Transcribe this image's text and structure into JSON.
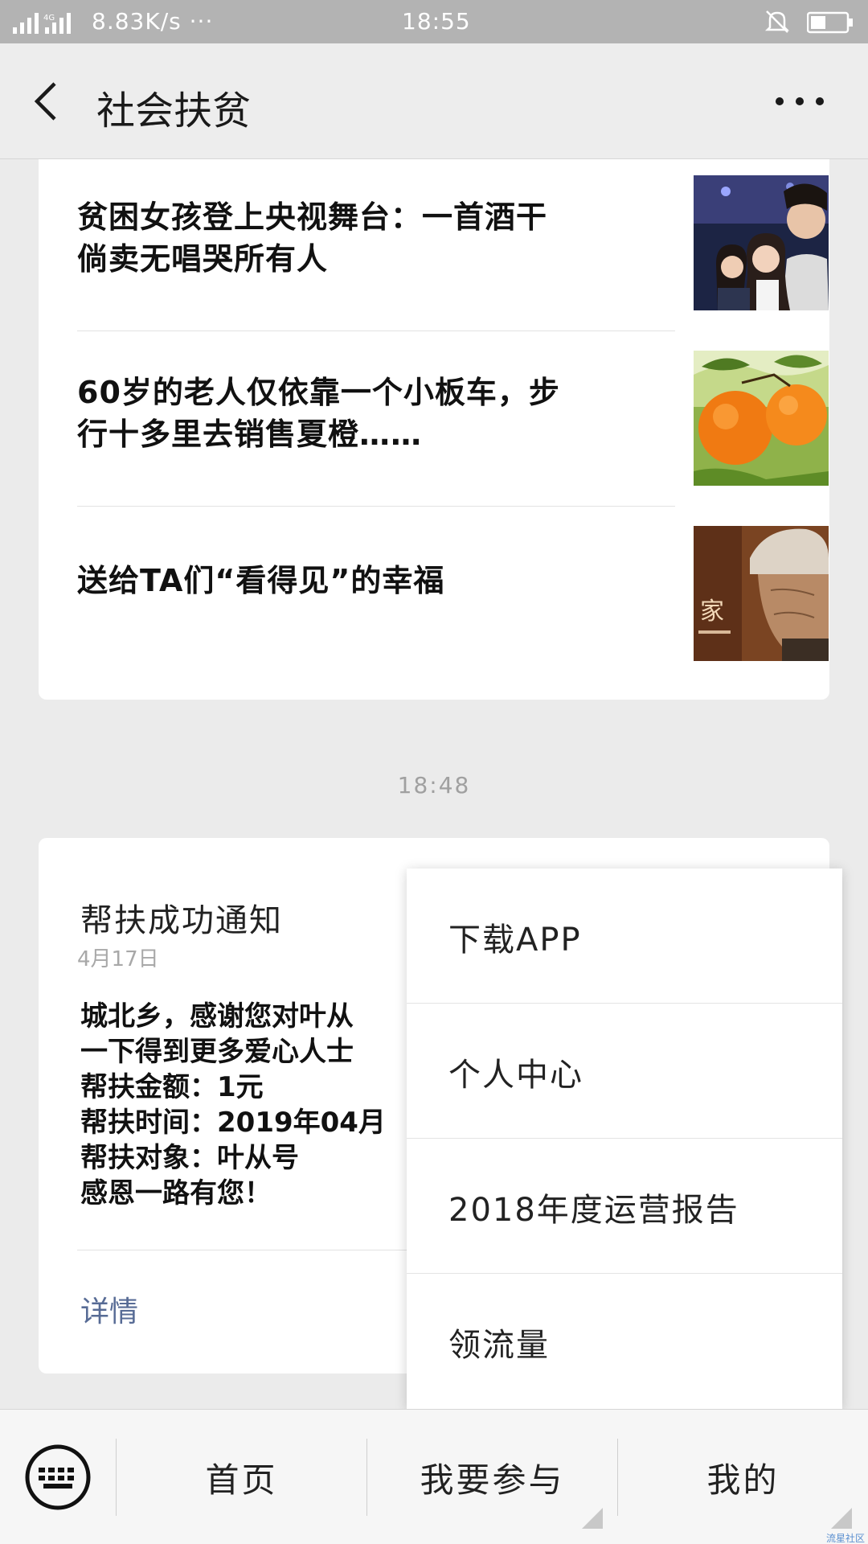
{
  "status_bar": {
    "speed": "8.83K/s",
    "dots": "···",
    "time": "18:55"
  },
  "header": {
    "title": "社会扶贫"
  },
  "articles": [
    {
      "title": "贫困女孩登上央视舞台：一首酒干倘卖无唱哭所有人",
      "thumb": "photo-stage-selfie"
    },
    {
      "title": "60岁的老人仅依靠一个小板车，步行十多里去销售夏橙……",
      "thumb": "photo-oranges"
    },
    {
      "title": "送给TA们“看得见”的幸福",
      "thumb": "photo-elderly-woman",
      "thumb_text": "家"
    }
  ],
  "timestamp": "18:48",
  "notice": {
    "title": "帮扶成功通知",
    "date": "4月17日",
    "body": "城北乡，感谢您对叶从\n一下得到更多爱心人士\n帮扶金额：1元\n帮扶时间：2019年04月\n帮扶对象：叶从号\n感恩一路有您！",
    "detail_label": "详情"
  },
  "popup_menu": {
    "items": [
      "下载APP",
      "个人中心",
      "2018年度运营报告",
      "领流量"
    ]
  },
  "bottom_menu": {
    "tabs": [
      "首页",
      "我要参与",
      "我的"
    ]
  },
  "watermark": "流星社区",
  "colors": {
    "status_bar": "#b3b3b3",
    "background": "#ebebeb",
    "link": "#576b95"
  }
}
